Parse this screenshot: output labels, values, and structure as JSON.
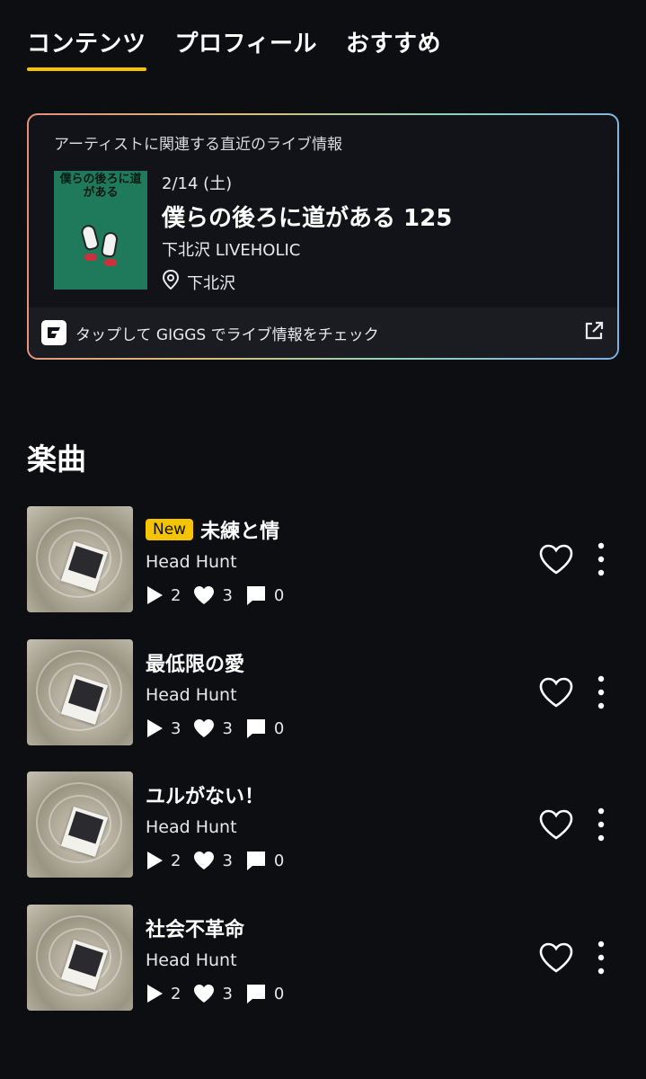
{
  "tabs": [
    {
      "label": "コンテンツ",
      "active": true
    },
    {
      "label": "プロフィール",
      "active": false
    },
    {
      "label": "おすすめ",
      "active": false
    }
  ],
  "live": {
    "heading": "アーティストに関連する直近のライブ情報",
    "flyer_title": "僕らの後ろに道がある",
    "date": "2/14 (土)",
    "title": "僕らの後ろに道がある 125",
    "venue": "下北沢 LIVEHOLIC",
    "location": "下北沢",
    "footer_text": "タップして GIGGS でライブ情報をチェック",
    "icons": {
      "location": "map-pin-icon",
      "brand": "giggs-logo-icon",
      "external": "external-link-icon"
    }
  },
  "songs_section": {
    "title": "楽曲"
  },
  "songs": [
    {
      "title": "未練と情",
      "badge": "New",
      "artist": "Head Hunt",
      "plays": "2",
      "likes": "3",
      "comments": "0"
    },
    {
      "title": "最低限の愛",
      "badge": "",
      "artist": "Head Hunt",
      "plays": "3",
      "likes": "3",
      "comments": "0"
    },
    {
      "title": "ユルがない！",
      "badge": "",
      "artist": "Head Hunt",
      "plays": "2",
      "likes": "3",
      "comments": "0"
    },
    {
      "title": "社会不革命",
      "badge": "",
      "artist": "Head Hunt",
      "plays": "2",
      "likes": "3",
      "comments": "0"
    }
  ],
  "colors": {
    "background": "#0d0e12",
    "accent": "#f5c400",
    "text": "#ffffff"
  }
}
